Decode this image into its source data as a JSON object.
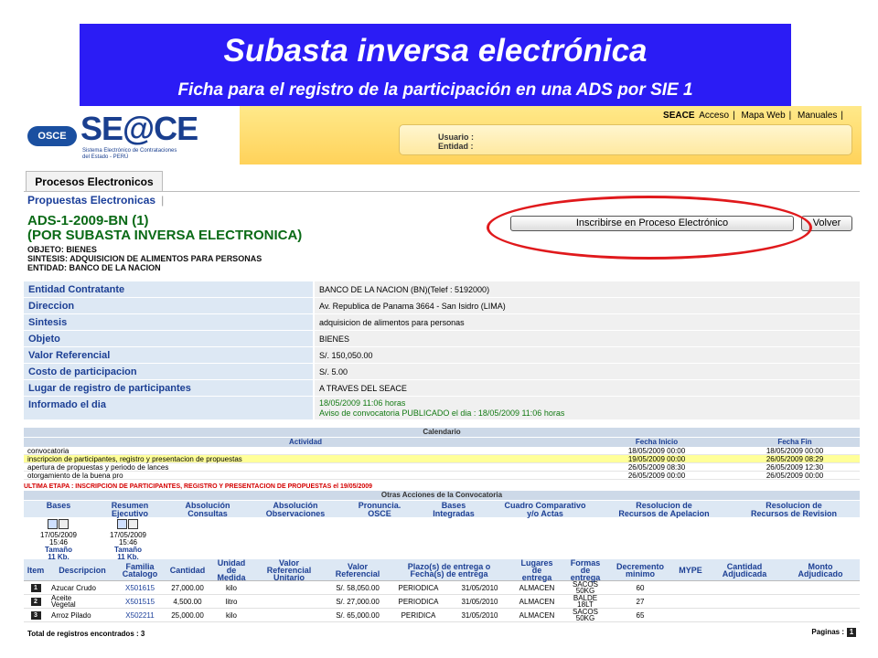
{
  "banner": {
    "title": "Subasta inversa electrónica",
    "subtitle": "Ficha para el registro de la participación en una ADS por SIE   1"
  },
  "header": {
    "osce": "OSCE",
    "brand": "SE@CE",
    "tagline1": "Sistema Electrónico de Contrataciones",
    "tagline2": "del Estado - PERÚ",
    "links": [
      "SEACE",
      "Acceso",
      "Mapa Web",
      "Manuales"
    ],
    "user_label": "Usuario :",
    "entity_label": "Entidad :"
  },
  "nav": {
    "tab": "Procesos Electronicos",
    "subnav": "Propuestas Electronicas",
    "subnav_sep": "|"
  },
  "process": {
    "code": "ADS-1-2009-BN (1)",
    "kind": "(POR SUBASTA INVERSA ELECTRONICA)",
    "objeto": "OBJETO: BIENES",
    "sintesis": "SINTESIS: ADQUISICION DE ALIMENTOS PARA PERSONAS",
    "entidad": "ENTIDAD: BANCO DE LA NACION",
    "btn_inscribir": "Inscribirse en Proceso Electrónico",
    "btn_volver": "Volver"
  },
  "detail": [
    {
      "label": "Entidad Contratante",
      "value": "BANCO DE LA NACION (BN)(Telef : 5192000)"
    },
    {
      "label": "Direccion",
      "value": "Av. Republica de Panama 3664 - San Isidro (LIMA)"
    },
    {
      "label": "Sintesis",
      "value": "adquisicion de alimentos para personas"
    },
    {
      "label": "Objeto",
      "value": "BIENES"
    },
    {
      "label": "Valor Referencial",
      "value": "S/. 150,050.00"
    },
    {
      "label": "Costo de participacion",
      "value": "S/. 5.00"
    },
    {
      "label": "Lugar de registro de participantes",
      "value": "A TRAVES DEL SEACE"
    }
  ],
  "informado": {
    "label": "Informado el dia",
    "line1": "18/05/2009 11:06 horas",
    "line2": "Aviso de convocatoria PUBLICADO el dia : 18/05/2009 11:06 horas"
  },
  "calendar": {
    "title": "Calendario",
    "col_actividad": "Actividad",
    "col_inicio": "Fecha Inicio",
    "col_fin": "Fecha Fin",
    "rows": [
      {
        "actividad": "convocatoria",
        "inicio": "18/05/2009 00:00",
        "fin": "18/05/2009 00:00"
      },
      {
        "actividad": "inscripcion de participantes, registro y presentacion de propuestas",
        "inicio": "19/05/2009 00:00",
        "fin": "26/05/2009 08:29"
      },
      {
        "actividad": "apertura de propuestas y periodo de lances",
        "inicio": "26/05/2009 08:30",
        "fin": "26/05/2009 12:30"
      },
      {
        "actividad": "otorgamiento de la buena pro",
        "inicio": "26/05/2009 00:00",
        "fin": "26/05/2009 00:00"
      }
    ],
    "ultima": "ULTIMA ETAPA : INSCRIPCION DE PARTICIPANTES, REGISTRO Y PRESENTACION DE PROPUESTAS el 19/05/2009"
  },
  "otras": {
    "title": "Otras Acciones de la Convocatoria",
    "cols": [
      "Bases",
      "Resumen\nEjecutivo",
      "Absolución\nConsultas",
      "Absolución\nObservaciones",
      "Pronuncia.\nOSCE",
      "Bases\nIntegradas",
      "Cuadro Comparativo\ny/o Actas",
      "Resolucion de\nRecursos de Apelacion",
      "Resolucion de\nRecursos de Revision"
    ],
    "docs": [
      {
        "date": "17/05/2009",
        "time": "15:46",
        "size_label": "Tamaño",
        "size": "11 Kb."
      },
      {
        "date": "17/05/2009",
        "time": "15:46",
        "size_label": "Tamaño",
        "size": "11 Kb."
      }
    ]
  },
  "items": {
    "headers": [
      "Item",
      "Descripcion",
      "Familia\nCatalogo",
      "Cantidad",
      "Unidad\nde\nMedida",
      "Valor\nReferencial\nUnitario",
      "Valor\nReferencial",
      "Plazo(s) de entrega o\nFecha(s) de entrega",
      "Lugares\nde\nentrega",
      "Formas\nde\nentrega",
      "Decremento\nminimo",
      "MYPE",
      "Cantidad\nAdjudicada",
      "Monto\nAdjudicado"
    ],
    "rows": [
      {
        "item": "1",
        "desc": "Azucar Crudo",
        "familia": "X501615",
        "cantidad": "27,000.00",
        "unidad": "kilo",
        "vru": "",
        "vr": "S/. 58,050.00",
        "plazo": "PERIODICA",
        "fecha": "31/05/2010",
        "lugar": "ALMACEN",
        "forma": "SACOS\n50KG",
        "decremento": "60",
        "mype": "",
        "cant_adj": "",
        "monto_adj": ""
      },
      {
        "item": "2",
        "desc": "Aceite\nVegetal",
        "familia": "X501515",
        "cantidad": "4,500.00",
        "unidad": "litro",
        "vru": "",
        "vr": "S/. 27,000.00",
        "plazo": "PERIODICA",
        "fecha": "31/05/2010",
        "lugar": "ALMACEN",
        "forma": "BALDE\n18LT",
        "decremento": "27",
        "mype": "",
        "cant_adj": "",
        "monto_adj": ""
      },
      {
        "item": "3",
        "desc": "Arroz Pilado",
        "familia": "X502211",
        "cantidad": "25,000.00",
        "unidad": "kilo",
        "vru": "",
        "vr": "S/. 65,000.00",
        "plazo": "PERIDICA",
        "fecha": "31/05/2010",
        "lugar": "ALMACEN",
        "forma": "SACOS\n50KG",
        "decremento": "65",
        "mype": "",
        "cant_adj": "",
        "monto_adj": ""
      }
    ],
    "total": "Total de registros encontrados : 3",
    "pages_label": "Paginas :",
    "page": "1"
  }
}
